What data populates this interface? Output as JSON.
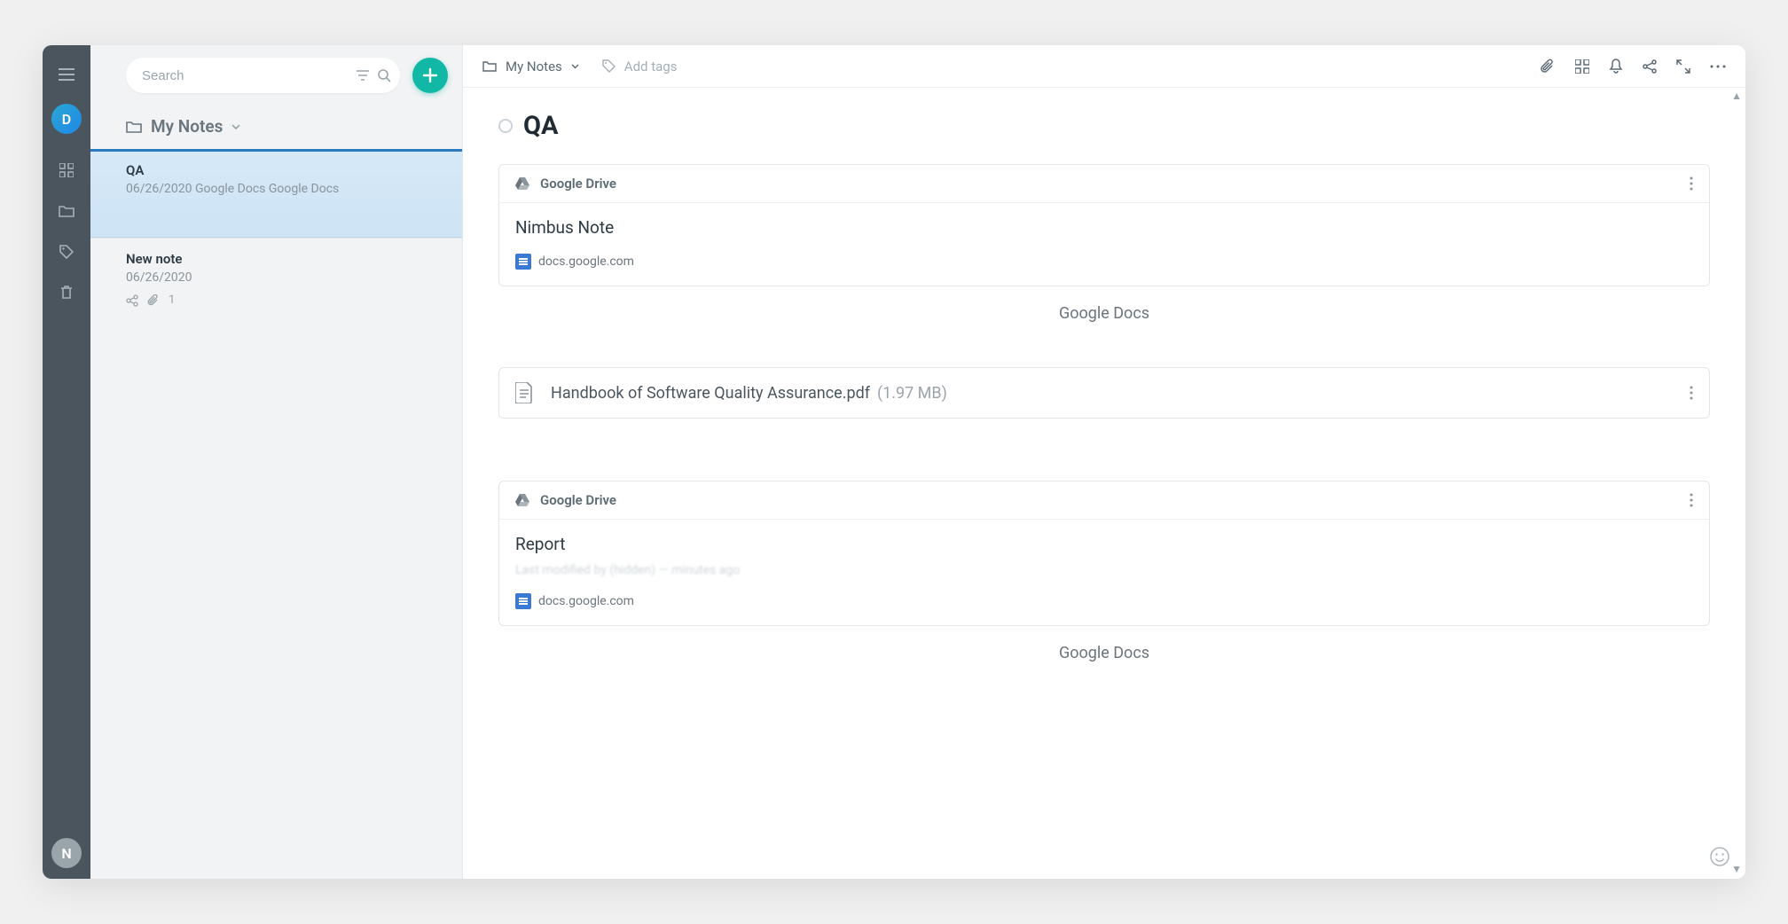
{
  "rail": {
    "avatar_letter": "D",
    "corner_letter": "N"
  },
  "search": {
    "placeholder": "Search"
  },
  "panel": {
    "folder_label": "My Notes"
  },
  "notes": [
    {
      "title": "QA",
      "date": "06/26/2020",
      "tail": "Google Docs Google Docs"
    },
    {
      "title": "New note",
      "date": "06/26/2020",
      "attach_count": "1"
    }
  ],
  "toolbar": {
    "breadcrumb": "My Notes",
    "add_tags": "Add tags"
  },
  "note": {
    "title": "QA",
    "cards": [
      {
        "source": "Google Drive",
        "doc_title": "Nimbus Note",
        "link_host": "docs.google.com",
        "caption": "Google Docs"
      },
      {
        "source": "Google Drive",
        "doc_title": "Report",
        "blurred_meta": "Last modified by (hidden) — minutes ago",
        "link_host": "docs.google.com",
        "caption": "Google Docs"
      }
    ],
    "attachment": {
      "name": "Handbook of Software Quality Assurance.pdf",
      "size": "(1.97 MB)"
    }
  }
}
